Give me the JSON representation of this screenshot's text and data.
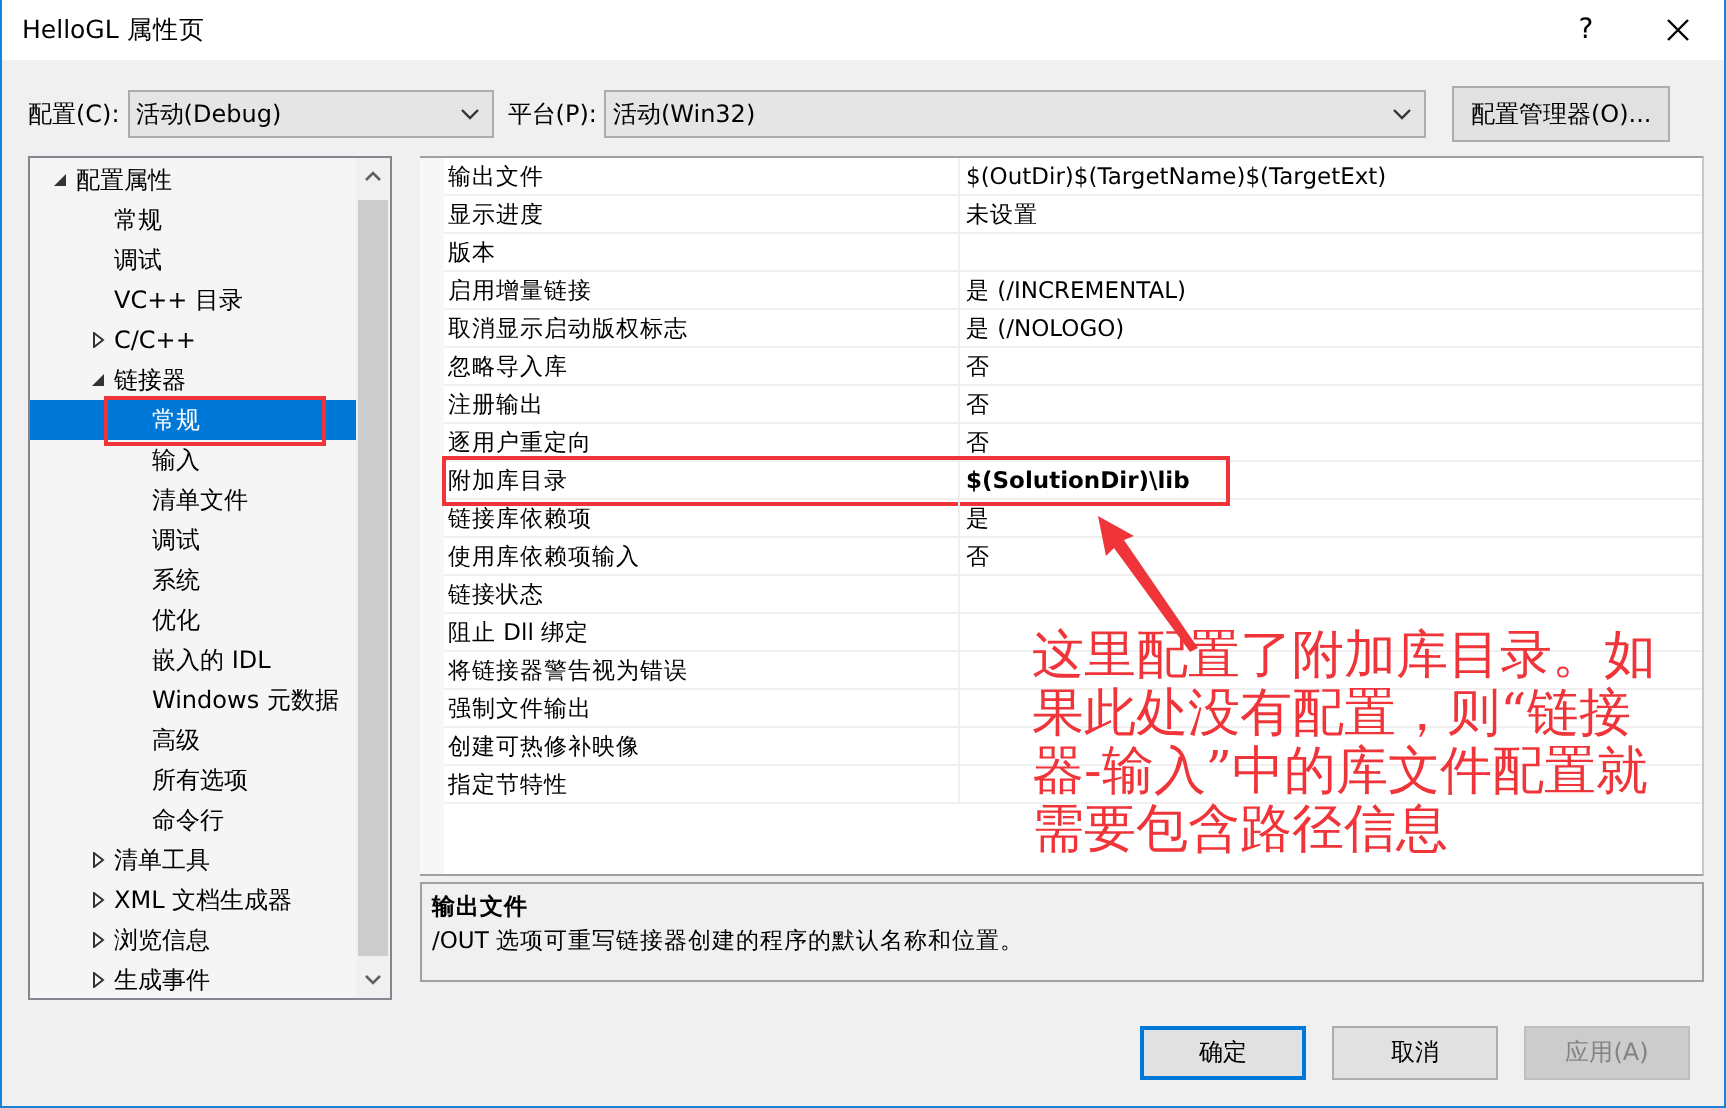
{
  "window": {
    "title": "HelloGL 属性页",
    "help_button": "?"
  },
  "toolbar": {
    "configuration": {
      "label": "配置(C):",
      "value": "活动(Debug)"
    },
    "platform": {
      "label": "平台(P):",
      "value": "活动(Win32)"
    },
    "manager_button": "配置管理器(O)..."
  },
  "tree": [
    {
      "label": "配置属性",
      "expanded": true,
      "selected": false,
      "children": [
        {
          "label": "常规",
          "selected": false
        },
        {
          "label": "调试",
          "selected": false
        },
        {
          "label": "VC++ 目录",
          "selected": false
        },
        {
          "label": "C/C++",
          "expanded": false,
          "selected": false
        },
        {
          "label": "链接器",
          "expanded": true,
          "selected": false,
          "children": [
            {
              "label": "常规",
              "selected": true,
              "annotated": true
            },
            {
              "label": "输入",
              "selected": false
            },
            {
              "label": "清单文件",
              "selected": false
            },
            {
              "label": "调试",
              "selected": false
            },
            {
              "label": "系统",
              "selected": false
            },
            {
              "label": "优化",
              "selected": false
            },
            {
              "label": "嵌入的 IDL",
              "selected": false
            },
            {
              "label": "Windows 元数据",
              "selected": false
            },
            {
              "label": "高级",
              "selected": false
            },
            {
              "label": "所有选项",
              "selected": false
            },
            {
              "label": "命令行",
              "selected": false
            }
          ]
        },
        {
          "label": "清单工具",
          "expanded": false,
          "selected": false
        },
        {
          "label": "XML 文档生成器",
          "expanded": false,
          "selected": false
        },
        {
          "label": "浏览信息",
          "expanded": false,
          "selected": false
        },
        {
          "label": "生成事件",
          "expanded": false,
          "selected": false
        }
      ]
    }
  ],
  "properties": [
    {
      "name": "输出文件",
      "value": "$(OutDir)$(TargetName)$(TargetExt)",
      "modified": false
    },
    {
      "name": "显示进度",
      "value": "未设置",
      "modified": false
    },
    {
      "name": "版本"
    },
    {
      "name": "启用增量链接",
      "value": "是 (/INCREMENTAL)",
      "modified": false
    },
    {
      "name": "取消显示启动版权标志",
      "value": "是 (/NOLOGO)",
      "modified": false
    },
    {
      "name": "忽略导入库",
      "value": "否",
      "modified": false
    },
    {
      "name": "注册输出",
      "value": "否",
      "modified": false
    },
    {
      "name": "逐用户重定向",
      "value": "否",
      "modified": false
    },
    {
      "name": "附加库目录",
      "value": "$(SolutionDir)\\lib",
      "modified": true,
      "annotated": true
    },
    {
      "name": "链接库依赖项",
      "value": "是",
      "modified": false
    },
    {
      "name": "使用库依赖项输入",
      "value": "否",
      "modified": false
    },
    {
      "name": "链接状态"
    },
    {
      "name": "阻止 Dll 绑定"
    },
    {
      "name": "将链接器警告视为错误"
    },
    {
      "name": "强制文件输出"
    },
    {
      "name": "创建可热修补映像"
    },
    {
      "name": "指定节特性"
    }
  ],
  "description": {
    "title": "输出文件",
    "text": "/OUT 选项可重写链接器创建的程序的默认名称和位置。"
  },
  "buttons": [
    {
      "label": "确定",
      "default": true,
      "disabled": false
    },
    {
      "label": "取消",
      "default": false,
      "disabled": false
    },
    {
      "label": "应用(A)",
      "default": false,
      "disabled": true
    }
  ],
  "annotation": {
    "text": "这里配置了附加库目录。如果此处没有配置，则“链接器-输入”中的库文件配置就需要包含路径信息"
  }
}
